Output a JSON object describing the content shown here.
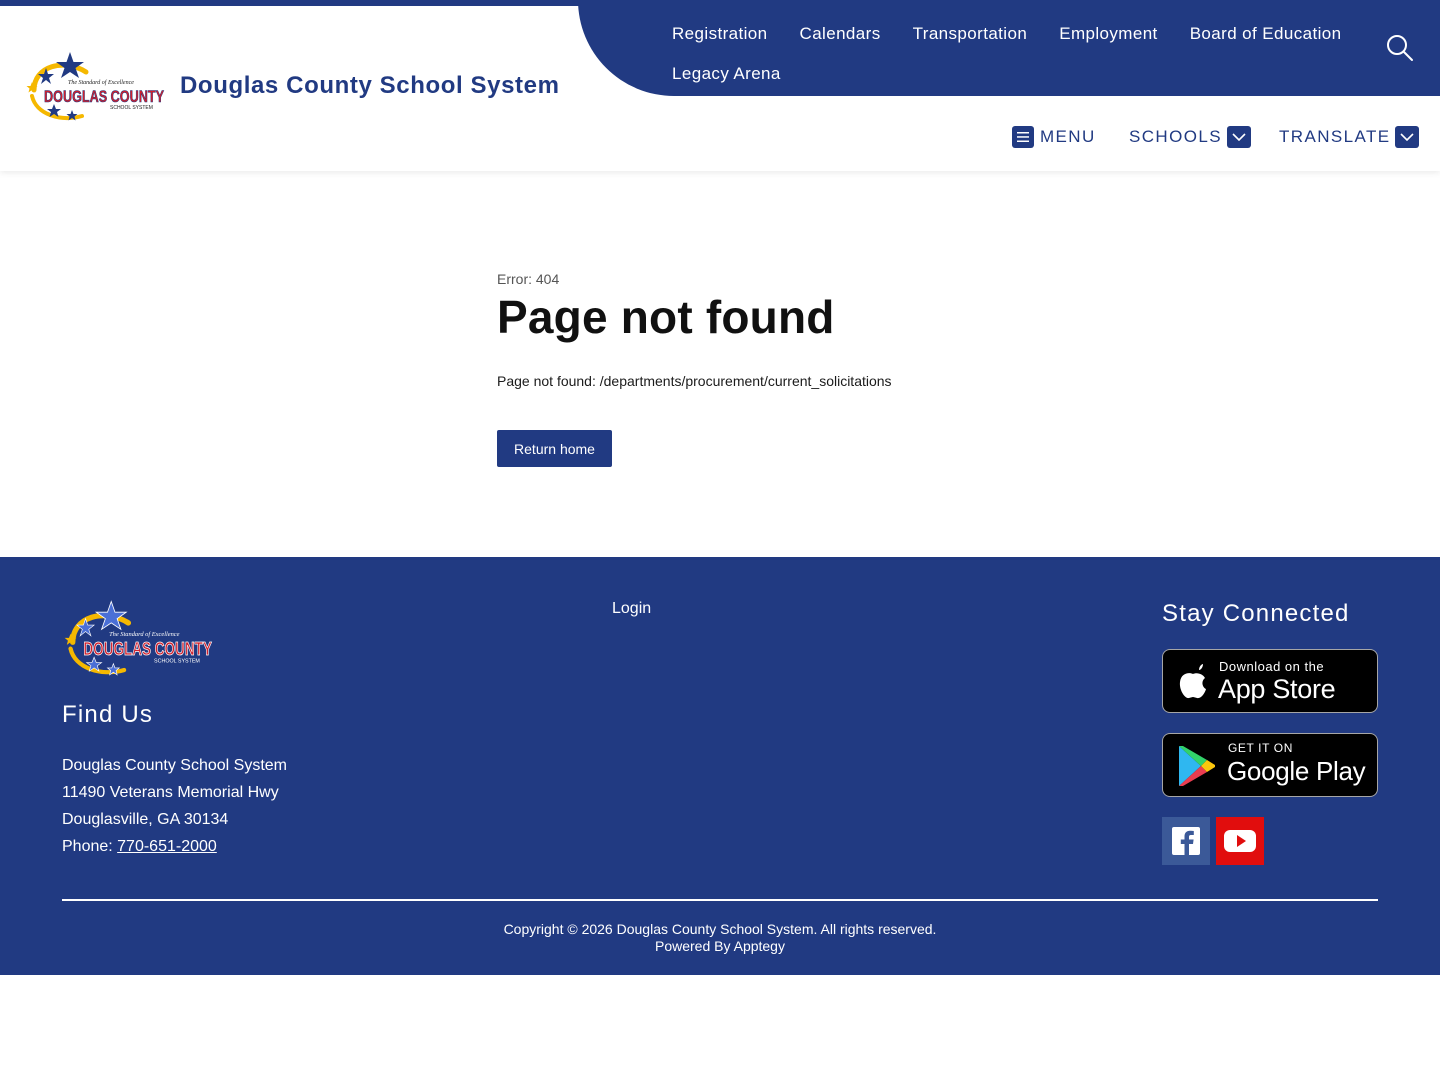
{
  "header": {
    "site_title": "Douglas County School System",
    "logo": {
      "tagline": "The Standard of Excellence",
      "name": "DOUGLAS COUNTY",
      "sub": "SCHOOL SYSTEM"
    },
    "quicklinks": [
      {
        "label": "Registration"
      },
      {
        "label": "Calendars"
      },
      {
        "label": "Transportation"
      },
      {
        "label": "Employment"
      },
      {
        "label": "Board of Education"
      },
      {
        "label": "Legacy Arena"
      }
    ],
    "search_icon": "search-icon",
    "nav": {
      "menu_label": "MENU",
      "schools_label": "SCHOOLS",
      "translate_label": "TRANSLATE"
    }
  },
  "main": {
    "error_code": "Error: 404",
    "title": "Page not found",
    "message": "Page not found: /departments/procurement/current_solicitations",
    "return_label": "Return home"
  },
  "footer": {
    "find_us": "Find Us",
    "address": {
      "name": "Douglas County School System",
      "street": "11490 Veterans Memorial Hwy",
      "city": "Douglasville, GA 30134",
      "phone_label": "Phone: ",
      "phone": "770-651-2000"
    },
    "login_label": "Login",
    "stay_connected": "Stay Connected",
    "app_store": {
      "small": "Download on the",
      "big": "App Store"
    },
    "google_play": {
      "small": "GET IT ON",
      "big": "Google Play"
    },
    "copyright": "Copyright © 2026 Douglas County School System. All rights reserved.",
    "powered_by": "Powered By Apptegy"
  },
  "colors": {
    "brand_blue": "#213a82",
    "white": "#ffffff",
    "youtube_red": "#e10d0d",
    "facebook_blue": "#3b5998",
    "logo_gold": "#f5b800",
    "logo_red": "#d0202e"
  }
}
